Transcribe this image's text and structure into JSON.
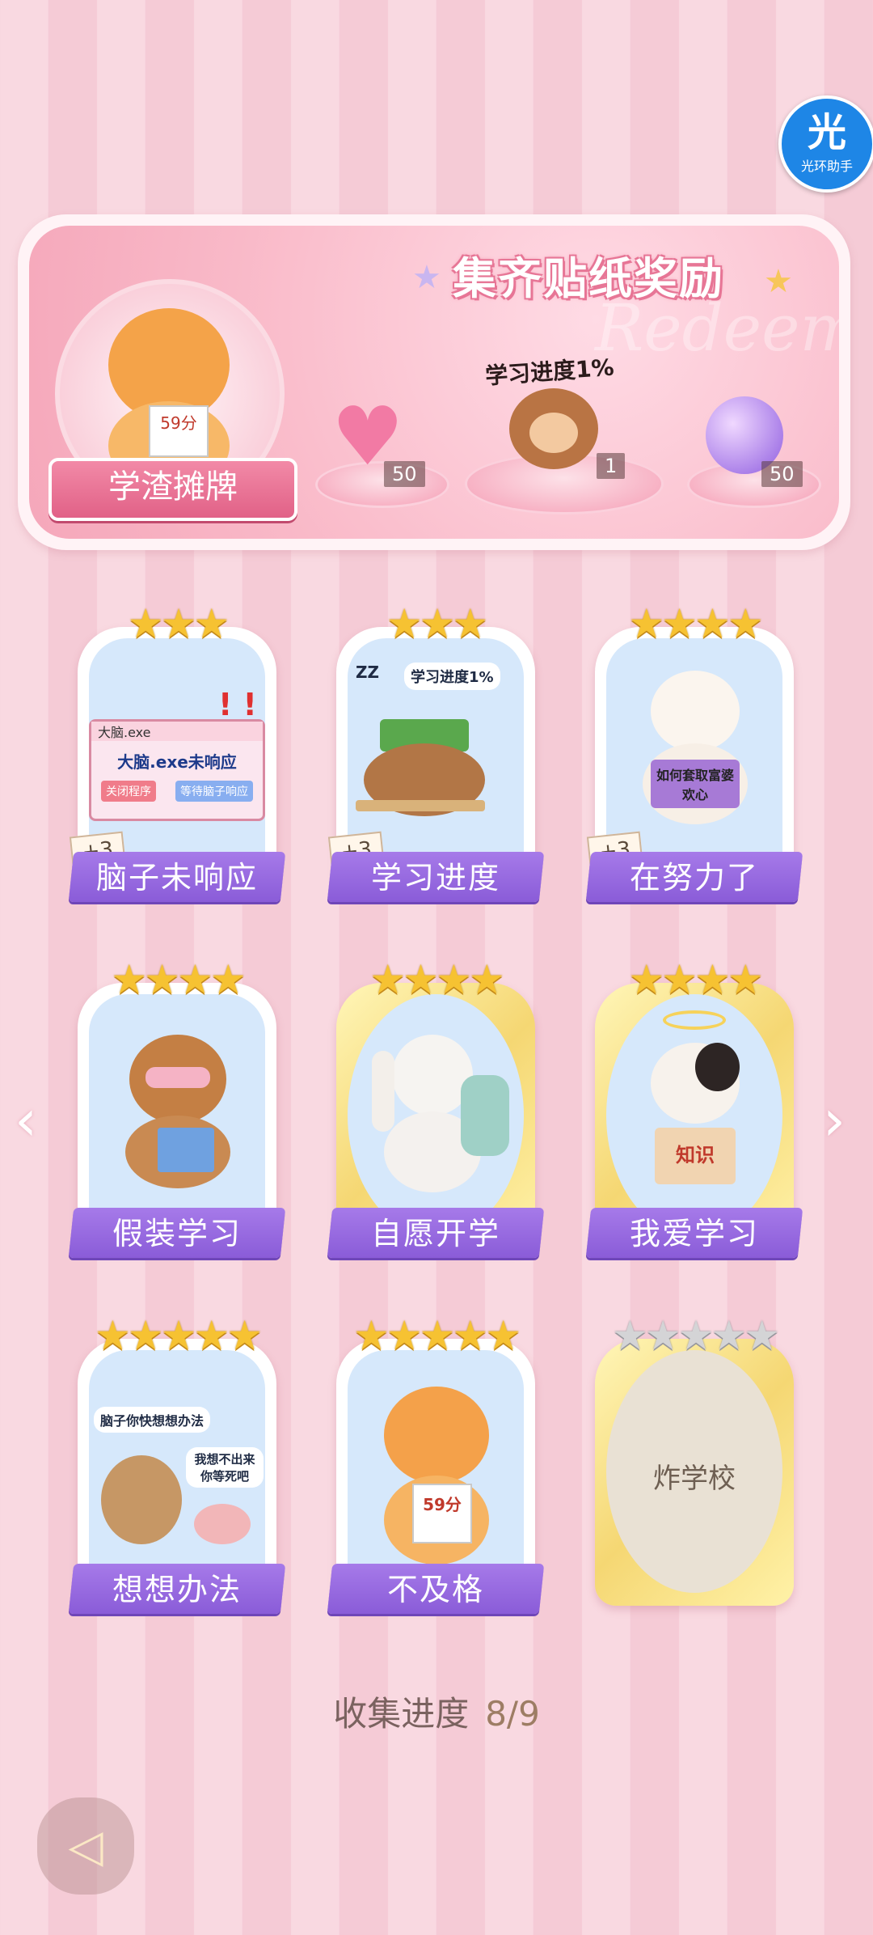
{
  "assistant": {
    "glyph": "光",
    "label": "光环助手"
  },
  "banner": {
    "title": "集齐贴纸奖励",
    "watermark": "Redeem",
    "featured_sticker": "学渣摊牌",
    "featured_score": "59分",
    "progress_label": "学习进度1%",
    "rewards": [
      {
        "icon": "heart-gem-icon",
        "count": "50"
      },
      {
        "icon": "monkey-sticker-icon",
        "count": "1"
      },
      {
        "icon": "energy-orb-icon",
        "count": "50"
      }
    ]
  },
  "cards": [
    {
      "name": "脑子未响应",
      "stars": 3,
      "bonus": "+3",
      "window_title": "大脑.exe",
      "window_message": "大脑.exe未响应",
      "btn_close": "关闭程序",
      "btn_wait": "等待脑子响应"
    },
    {
      "name": "学习进度",
      "stars": 3,
      "bonus": "+3",
      "bubble": "学习进度1%",
      "zz": "ZZ"
    },
    {
      "name": "在努力了",
      "stars": 4,
      "bonus": "+3",
      "book_text": "如何套取富婆欢心"
    },
    {
      "name": "假装学习",
      "stars": 4
    },
    {
      "name": "自愿开学",
      "stars": 4
    },
    {
      "name": "我爱学习",
      "stars": 4,
      "book_text": "知识"
    },
    {
      "name": "想想办法",
      "stars": 5,
      "bubble1": "脑子你快想想办法",
      "bubble2": "我想不出来你等死吧"
    },
    {
      "name": "不及格",
      "stars": 5,
      "score": "59分"
    },
    {
      "name": "炸学校",
      "stars": 5,
      "locked": true
    }
  ],
  "stars_glyph": {
    "3": "★★★",
    "4": "★★★★",
    "5": "★★★★★"
  },
  "collection": {
    "label": "收集进度",
    "value": "8/9"
  },
  "nav": {
    "prev": "‹",
    "next": "›",
    "back": "◁"
  }
}
